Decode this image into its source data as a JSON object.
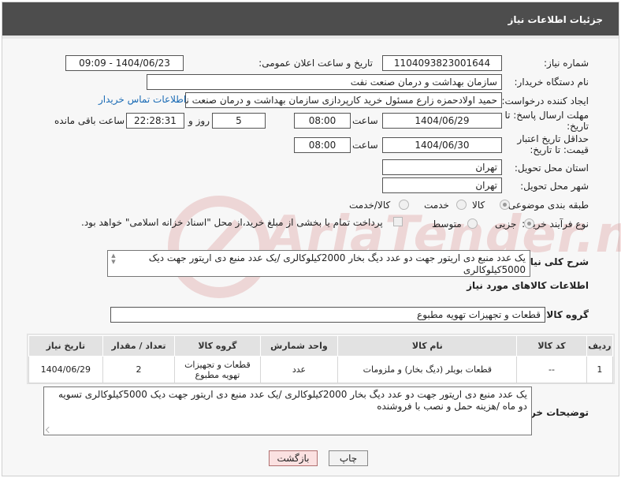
{
  "header": {
    "title": "جزئیات اطلاعات نیاز"
  },
  "need_number": {
    "label": "شماره نیاز:",
    "value": "1104093823001644"
  },
  "announce_datetime": {
    "label": "تاریخ و ساعت اعلان عمومی:",
    "value": "1404/06/23 - 09:09"
  },
  "buyer_org": {
    "label": "نام دستگاه خریدار:",
    "value": "سازمان بهداشت و درمان صنعت نفت"
  },
  "requester": {
    "label": "ایجاد کننده درخواست:",
    "value": "حمید اولادحمزه زارع مسئول خرید کارپردازی سازمان بهداشت و درمان صنعت نفت",
    "contact_link": "اطلاعات تماس خریدار"
  },
  "reply_deadline": {
    "label": "مهلت ارسال پاسخ: تا تاریخ:",
    "date": "1404/06/29",
    "time_label": "ساعت",
    "time": "08:00",
    "days": "5",
    "days_label": "روز و",
    "remaining": "22:28:31",
    "remaining_label": "ساعت باقی مانده"
  },
  "price_validity": {
    "label": "حداقل تاریخ اعتبار قیمت: تا تاریخ:",
    "date": "1404/06/30",
    "time_label": "ساعت",
    "time": "08:00"
  },
  "province": {
    "label": "استان محل تحویل:",
    "value": "تهران"
  },
  "city": {
    "label": "شهر محل تحویل:",
    "value": "تهران"
  },
  "category": {
    "label": "طبقه بندی موضوعی:",
    "options": [
      "کالا",
      "خدمت",
      "کالا/خدمت"
    ],
    "selected": 0
  },
  "process_type": {
    "label": "نوع فرآیند خرید :",
    "options": [
      "جزیی",
      "متوسط"
    ],
    "selected": 0,
    "note": "پرداخت تمام یا بخشی از مبلغ خرید،از محل \"اسناد خزانه اسلامی\" خواهد بود."
  },
  "description": {
    "label": "شرح کلی نیاز:",
    "value": "یک عدد منبع دی اریتور جهت دو عدد دیگ بخار 2000کیلوکالری /یک عدد منبع دی اریتور جهت دیک 5000کیلوکالری"
  },
  "goods_info": {
    "title": "اطلاعات کالاهای مورد نیاز"
  },
  "goods_group": {
    "label": "گروه کالا:",
    "value": "قطعات و تجهیزات تهویه مطبوع"
  },
  "table": {
    "headers": [
      "ردیف",
      "کد کالا",
      "نام کالا",
      "واحد شمارش",
      "گروه کالا",
      "تعداد / مقدار",
      "تاریخ نیاز"
    ],
    "rows": [
      [
        "1",
        "--",
        "قطعات بویلر (دیگ بخار) و ملزومات",
        "عدد",
        "قطعات و تجهیزات تهویه مطبوع",
        "2",
        "1404/06/29"
      ]
    ]
  },
  "buyer_notes": {
    "label": "توضیحات خریدار:",
    "value": "یک عدد منبع دی اریتور جهت دو عدد دیگ بخار 2000کیلوکالری /یک عدد منبع دی اریتور جهت دیک 5000کیلوکالری تسویه دو ماه /هزینه حمل و نصب با فروشنده"
  },
  "buttons": {
    "print": "چاپ",
    "back": "بازگشت"
  },
  "watermark": {
    "text": "AriaTender.neT"
  }
}
